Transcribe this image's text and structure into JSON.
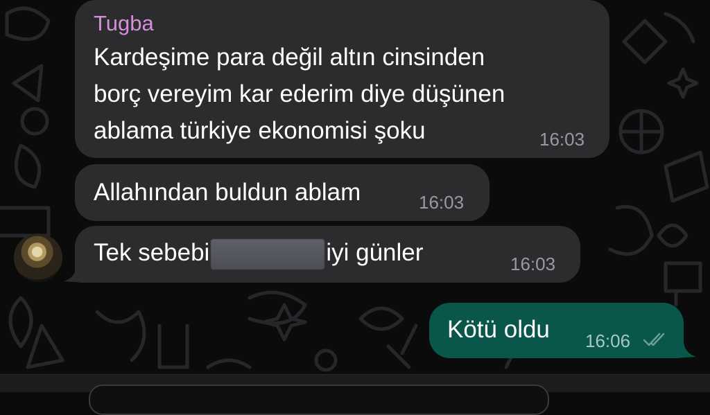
{
  "messages": [
    {
      "sender": "Tugba",
      "lines": [
        "Kardeşime para değil altın cinsinden",
        "borç vereyim kar ederim diye düşünen",
        "ablama türkiye ekonomisi şoku"
      ],
      "time": "16:03"
    },
    {
      "text": "Allahından buldun ablam",
      "time": "16:03"
    },
    {
      "text_before": "Tek sebebi",
      "text_after": "iyi günler",
      "time": "16:03"
    },
    {
      "text": "Kötü oldu",
      "time": "16:06"
    }
  ],
  "icons": {
    "avatar": "contact-photo",
    "read_receipt": "double-check-icon"
  },
  "colors": {
    "background": "#0b0b0c",
    "incoming_bubble": "#2c2c2e",
    "outgoing_bubble": "#09574a",
    "sender_name": "#d38fd8",
    "timestamp": "#9a9a9e"
  }
}
